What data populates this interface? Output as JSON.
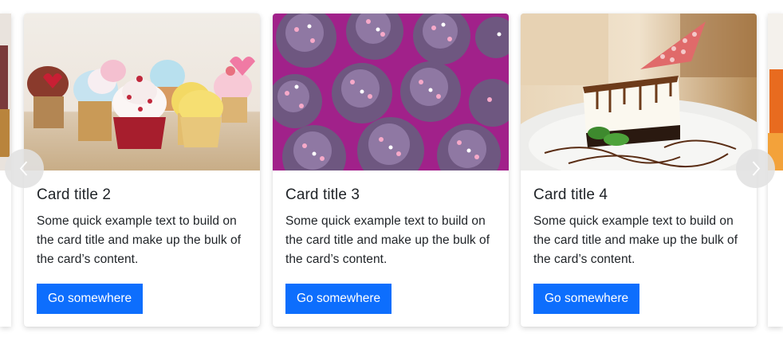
{
  "carousel": {
    "prev_icon": "chevron-left-icon",
    "next_icon": "chevron-right-icon",
    "cards": [
      {
        "title": "Card title 2",
        "text": "Some quick example text to build on the card title and make up the bulk of the card’s content.",
        "button_label": "Go somewhere",
        "image": "colorful-cupcakes-photo"
      },
      {
        "title": "Card title 3",
        "text": "Some quick example text to build on the card title and make up the bulk of the card’s content.",
        "button_label": "Go somewhere",
        "image": "purple-cupcakes-photo"
      },
      {
        "title": "Card title 4",
        "text": "Some quick example text to build on the card title and make up the bulk of the card’s content.",
        "button_label": "Go somewhere",
        "image": "cheesecake-slice-photo"
      }
    ]
  },
  "colors": {
    "button": "#0d6efd",
    "button_text": "#ffffff",
    "text": "#212529",
    "nav_button": "#e1e1e1"
  }
}
